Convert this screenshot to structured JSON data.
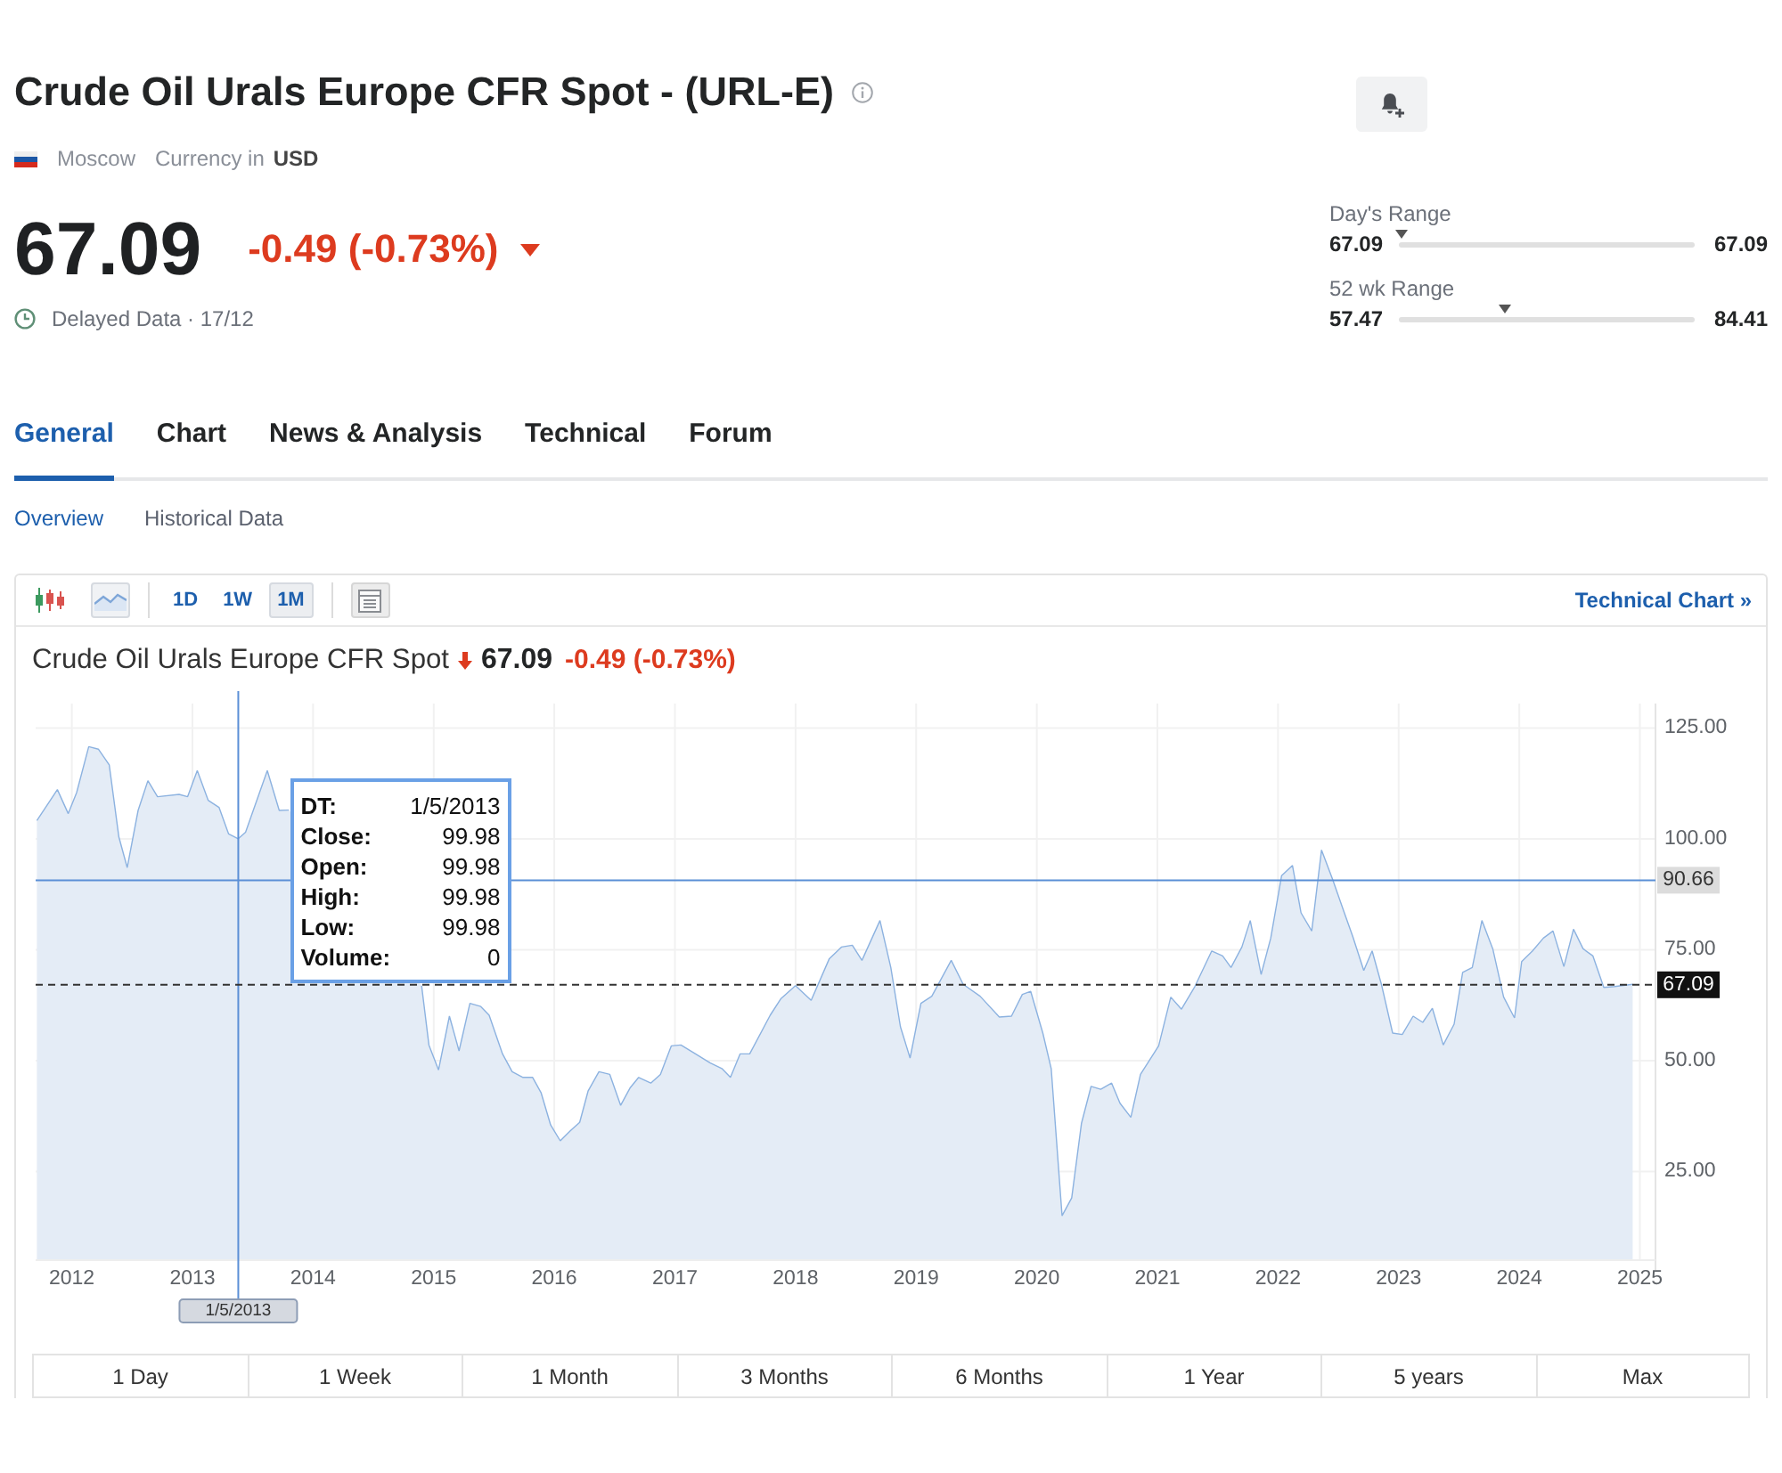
{
  "header": {
    "title": "Crude Oil Urals Europe CFR Spot - (URL-E)",
    "exchange": "Moscow",
    "currency_label": "Currency in",
    "currency": "USD",
    "price": "67.09",
    "change": "-0.49 (-0.73%)",
    "down": true,
    "delay_note": "Delayed Data · 17/12"
  },
  "ranges": [
    {
      "label": "Day's Range",
      "low": "67.09",
      "high": "67.09",
      "level": 0.01
    },
    {
      "label": "52 wk Range",
      "low": "57.47",
      "high": "84.41",
      "level": 0.36
    }
  ],
  "tabs": [
    {
      "label": "General",
      "selected": true
    },
    {
      "label": "Chart",
      "selected": false
    },
    {
      "label": "News & Analysis",
      "selected": false
    },
    {
      "label": "Technical",
      "selected": false
    },
    {
      "label": "Forum",
      "selected": false
    }
  ],
  "subtabs": [
    {
      "label": "Overview",
      "selected": true
    },
    {
      "label": "Historical Data",
      "selected": false
    }
  ],
  "chart": {
    "toolbar": {
      "chart_types": [
        {
          "kind": "candlestick",
          "selected": false
        },
        {
          "kind": "area",
          "selected": true
        }
      ],
      "intervals": [
        {
          "label": "1D",
          "selected": false
        },
        {
          "label": "1W",
          "selected": false
        },
        {
          "label": "1M",
          "selected": true
        }
      ],
      "tools": [
        {
          "kind": "table"
        }
      ],
      "link": "Technical Chart »"
    },
    "header": {
      "price": "67.09",
      "change": "-0.49 (-0.73%)",
      "down": true
    },
    "chart_data": {
      "type": "area",
      "title": "Crude Oil Urals Europe CFR Spot",
      "x": [
        2011.71,
        2011.88,
        2011.97,
        2012.04,
        2012.14,
        2012.22,
        2012.31,
        2012.39,
        2012.46,
        2012.55,
        2012.63,
        2012.71,
        2012.89,
        2012.96,
        2013.04,
        2013.13,
        2013.22,
        2013.3,
        2013.38,
        2013.44,
        2013.62,
        2013.72,
        2013.8,
        2013.95,
        2014.1,
        2014.3,
        2014.45,
        2014.6,
        2014.75,
        2014.85,
        2014.9,
        2014.96,
        2015.04,
        2015.13,
        2015.21,
        2015.3,
        2015.39,
        2015.46,
        2015.57,
        2015.65,
        2015.74,
        2015.82,
        2015.89,
        2015.97,
        2016.05,
        2016.13,
        2016.21,
        2016.28,
        2016.37,
        2016.46,
        2016.55,
        2016.63,
        2016.7,
        2016.8,
        2016.88,
        2016.97,
        2017.05,
        2017.17,
        2017.29,
        2017.39,
        2017.46,
        2017.54,
        2017.62,
        2017.79,
        2017.88,
        2018.0,
        2018.13,
        2018.28,
        2018.38,
        2018.47,
        2018.55,
        2018.7,
        2018.79,
        2018.87,
        2018.95,
        2019.04,
        2019.13,
        2019.29,
        2019.39,
        2019.53,
        2019.69,
        2019.79,
        2019.88,
        2019.95,
        2020.05,
        2020.12,
        2020.21,
        2020.29,
        2020.37,
        2020.45,
        2020.53,
        2020.62,
        2020.69,
        2020.78,
        2020.86,
        2021.01,
        2021.11,
        2021.2,
        2021.31,
        2021.45,
        2021.54,
        2021.61,
        2021.7,
        2021.77,
        2021.86,
        2021.94,
        2022.03,
        2022.12,
        2022.19,
        2022.28,
        2022.36,
        2022.45,
        2022.55,
        2022.62,
        2022.71,
        2022.78,
        2022.86,
        2022.95,
        2023.03,
        2023.12,
        2023.2,
        2023.28,
        2023.37,
        2023.46,
        2023.53,
        2023.61,
        2023.69,
        2023.78,
        2023.87,
        2023.96,
        2024.02,
        2024.11,
        2024.2,
        2024.28,
        2024.37,
        2024.45,
        2024.53,
        2024.61,
        2024.7,
        2024.79,
        2024.94
      ],
      "values": [
        104.1,
        111.1,
        105.7,
        110.4,
        120.8,
        120.2,
        116.7,
        100.4,
        93.5,
        106.4,
        113.1,
        109.5,
        110.0,
        109.5,
        115.4,
        108.7,
        107.1,
        101.1,
        100.0,
        101.5,
        115.4,
        106.4,
        106.5,
        null,
        null,
        null,
        null,
        null,
        null,
        null,
        66.9,
        53.5,
        47.9,
        60.0,
        52.2,
        62.9,
        62.2,
        60.2,
        51.5,
        47.5,
        46.2,
        46.2,
        42.8,
        35.5,
        31.9,
        34.1,
        36.1,
        43.1,
        47.5,
        46.9,
        39.9,
        43.9,
        46.2,
        44.9,
        46.9,
        53.3,
        53.5,
        51.5,
        49.5,
        48.2,
        46.2,
        51.5,
        51.5,
        60.2,
        64.0,
        66.9,
        63.6,
        73.0,
        75.6,
        76.0,
        72.6,
        81.6,
        71.0,
        57.6,
        50.6,
        62.9,
        64.5,
        72.6,
        67.2,
        64.5,
        59.8,
        60.0,
        64.9,
        65.6,
        56.2,
        48.2,
        15.0,
        19.0,
        35.9,
        44.2,
        43.5,
        44.9,
        40.4,
        37.2,
        46.9,
        53.3,
        64.3,
        61.6,
        66.7,
        74.7,
        73.6,
        71.0,
        75.6,
        81.6,
        69.4,
        77.6,
        91.7,
        94.0,
        83.3,
        79.2,
        97.5,
        91.0,
        83.3,
        77.9,
        70.3,
        74.7,
        66.9,
        56.2,
        55.9,
        60.0,
        58.6,
        61.8,
        53.5,
        58.2,
        69.9,
        71.0,
        81.6,
        75.2,
        64.3,
        59.6,
        72.3,
        74.7,
        77.6,
        79.2,
        71.2,
        79.6,
        75.2,
        73.6,
        66.5,
        66.7,
        67.2
      ],
      "xlim": [
        2011.7,
        2025.07
      ],
      "ylim": [
        5.2,
        130.5
      ],
      "grid": true,
      "xticks": [
        2012,
        2013,
        2014,
        2015,
        2016,
        2017,
        2018,
        2019,
        2020,
        2021,
        2022,
        2023,
        2024,
        2025
      ],
      "yticks": [
        {
          "value": 25,
          "label": "25.00"
        },
        {
          "value": 50,
          "label": "50.00"
        },
        {
          "value": 75,
          "label": "75.00"
        },
        {
          "value": 100,
          "label": "100.00"
        },
        {
          "value": 125,
          "label": "125.00"
        }
      ],
      "ref_lines": [
        {
          "axis": "x",
          "value": 2013.38,
          "label": "1/5/2013",
          "color": "#5b8fd6"
        },
        {
          "axis": "y",
          "value": 90.66,
          "label": "90.66",
          "color": "#5b8fd6"
        },
        {
          "axis": "y",
          "value": 67.09,
          "label": "67.09",
          "color": "#333333"
        }
      ]
    },
    "tooltip": {
      "rows": [
        {
          "label": "DT:",
          "value": "1/5/2013"
        },
        {
          "label": "Close:",
          "value": "99.98"
        },
        {
          "label": "Open:",
          "value": "99.98"
        },
        {
          "label": "High:",
          "value": "99.98"
        },
        {
          "label": "Low:",
          "value": "99.98"
        },
        {
          "label": "Volume:",
          "value": "0"
        }
      ]
    },
    "periods": [
      "1 Day",
      "1 Week",
      "1 Month",
      "3 Months",
      "6 Months",
      "1 Year",
      "5 years",
      "Max"
    ]
  }
}
